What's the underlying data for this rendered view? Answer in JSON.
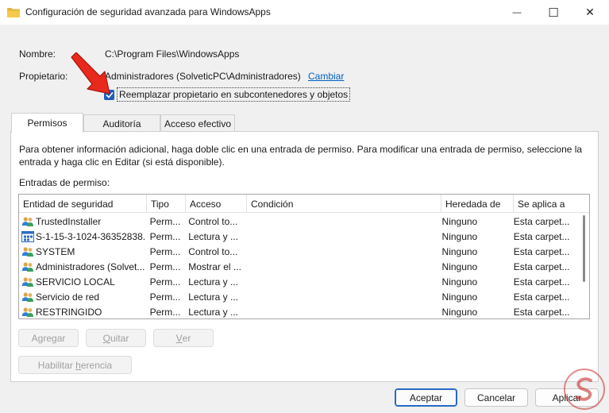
{
  "window": {
    "title": "Configuración de seguridad avanzada para WindowsApps",
    "minimize_glyph": "—",
    "maximize_glyph": "☐",
    "close_glyph": "✕"
  },
  "owner_section": {
    "name_label": "Nombre:",
    "name_value": "C:\\Program Files\\WindowsApps",
    "owner_label": "Propietario:",
    "owner_value": "Administradores (SolveticPC\\Administradores)",
    "change_link": "Cambiar",
    "replace_owner_checkbox": "Reemplazar propietario en subcontenedores y objetos",
    "replace_owner_checked": true
  },
  "tabs": [
    {
      "label": "Permisos",
      "active": true
    },
    {
      "label": "Auditoría",
      "active": false
    },
    {
      "label": "Acceso efectivo",
      "active": false
    }
  ],
  "permissions": {
    "info_text": "Para obtener información adicional, haga doble clic en una entrada de permiso. Para modificar una entrada de permiso, seleccione la entrada y haga clic en Editar (si está disponible).",
    "entries_label": "Entradas de permiso:",
    "columns": [
      "Entidad de seguridad",
      "Tipo",
      "Acceso",
      "Condición",
      "Heredada de",
      "Se aplica a"
    ],
    "rows": [
      {
        "principal": "TrustedInstaller",
        "icon": "users-icon",
        "type": "Perm...",
        "access": "Control to...",
        "condition": "",
        "inherited": "Ninguno",
        "applies": "Esta carpet..."
      },
      {
        "principal": "S-1-15-3-1024-36352838...",
        "icon": "app-package-icon",
        "type": "Perm...",
        "access": "Lectura y ...",
        "condition": "",
        "inherited": "Ninguno",
        "applies": "Esta carpet..."
      },
      {
        "principal": "SYSTEM",
        "icon": "users-icon",
        "type": "Perm...",
        "access": "Control to...",
        "condition": "",
        "inherited": "Ninguno",
        "applies": "Esta carpet..."
      },
      {
        "principal": "Administradores (Solvet...",
        "icon": "users-icon",
        "type": "Perm...",
        "access": "Mostrar el ...",
        "condition": "",
        "inherited": "Ninguno",
        "applies": "Esta carpet..."
      },
      {
        "principal": "SERVICIO LOCAL",
        "icon": "users-icon",
        "type": "Perm...",
        "access": "Lectura y ...",
        "condition": "",
        "inherited": "Ninguno",
        "applies": "Esta carpet..."
      },
      {
        "principal": "Servicio de red",
        "icon": "users-icon",
        "type": "Perm...",
        "access": "Lectura y ...",
        "condition": "",
        "inherited": "Ninguno",
        "applies": "Esta carpet..."
      },
      {
        "principal": "RESTRINGIDO",
        "icon": "users-icon",
        "type": "Perm...",
        "access": "Lectura y ...",
        "condition": "",
        "inherited": "Ninguno",
        "applies": "Esta carpet..."
      }
    ],
    "buttons": {
      "add": {
        "pre": "A",
        "key": "g",
        "post": "regar"
      },
      "remove": {
        "pre": "",
        "key": "Q",
        "post": "uitar"
      },
      "view": {
        "pre": "",
        "key": "V",
        "post": "er"
      },
      "inherit": {
        "pre": "Habilitar ",
        "key": "h",
        "post": "erencia"
      }
    }
  },
  "footer": {
    "accept": "Aceptar",
    "cancel": "Cancelar",
    "apply": "Aplicar"
  },
  "colors": {
    "accent": "#1f5fb9",
    "link": "#0060c0",
    "arrow": "#e8291c",
    "watermark": "#c62d2d"
  }
}
